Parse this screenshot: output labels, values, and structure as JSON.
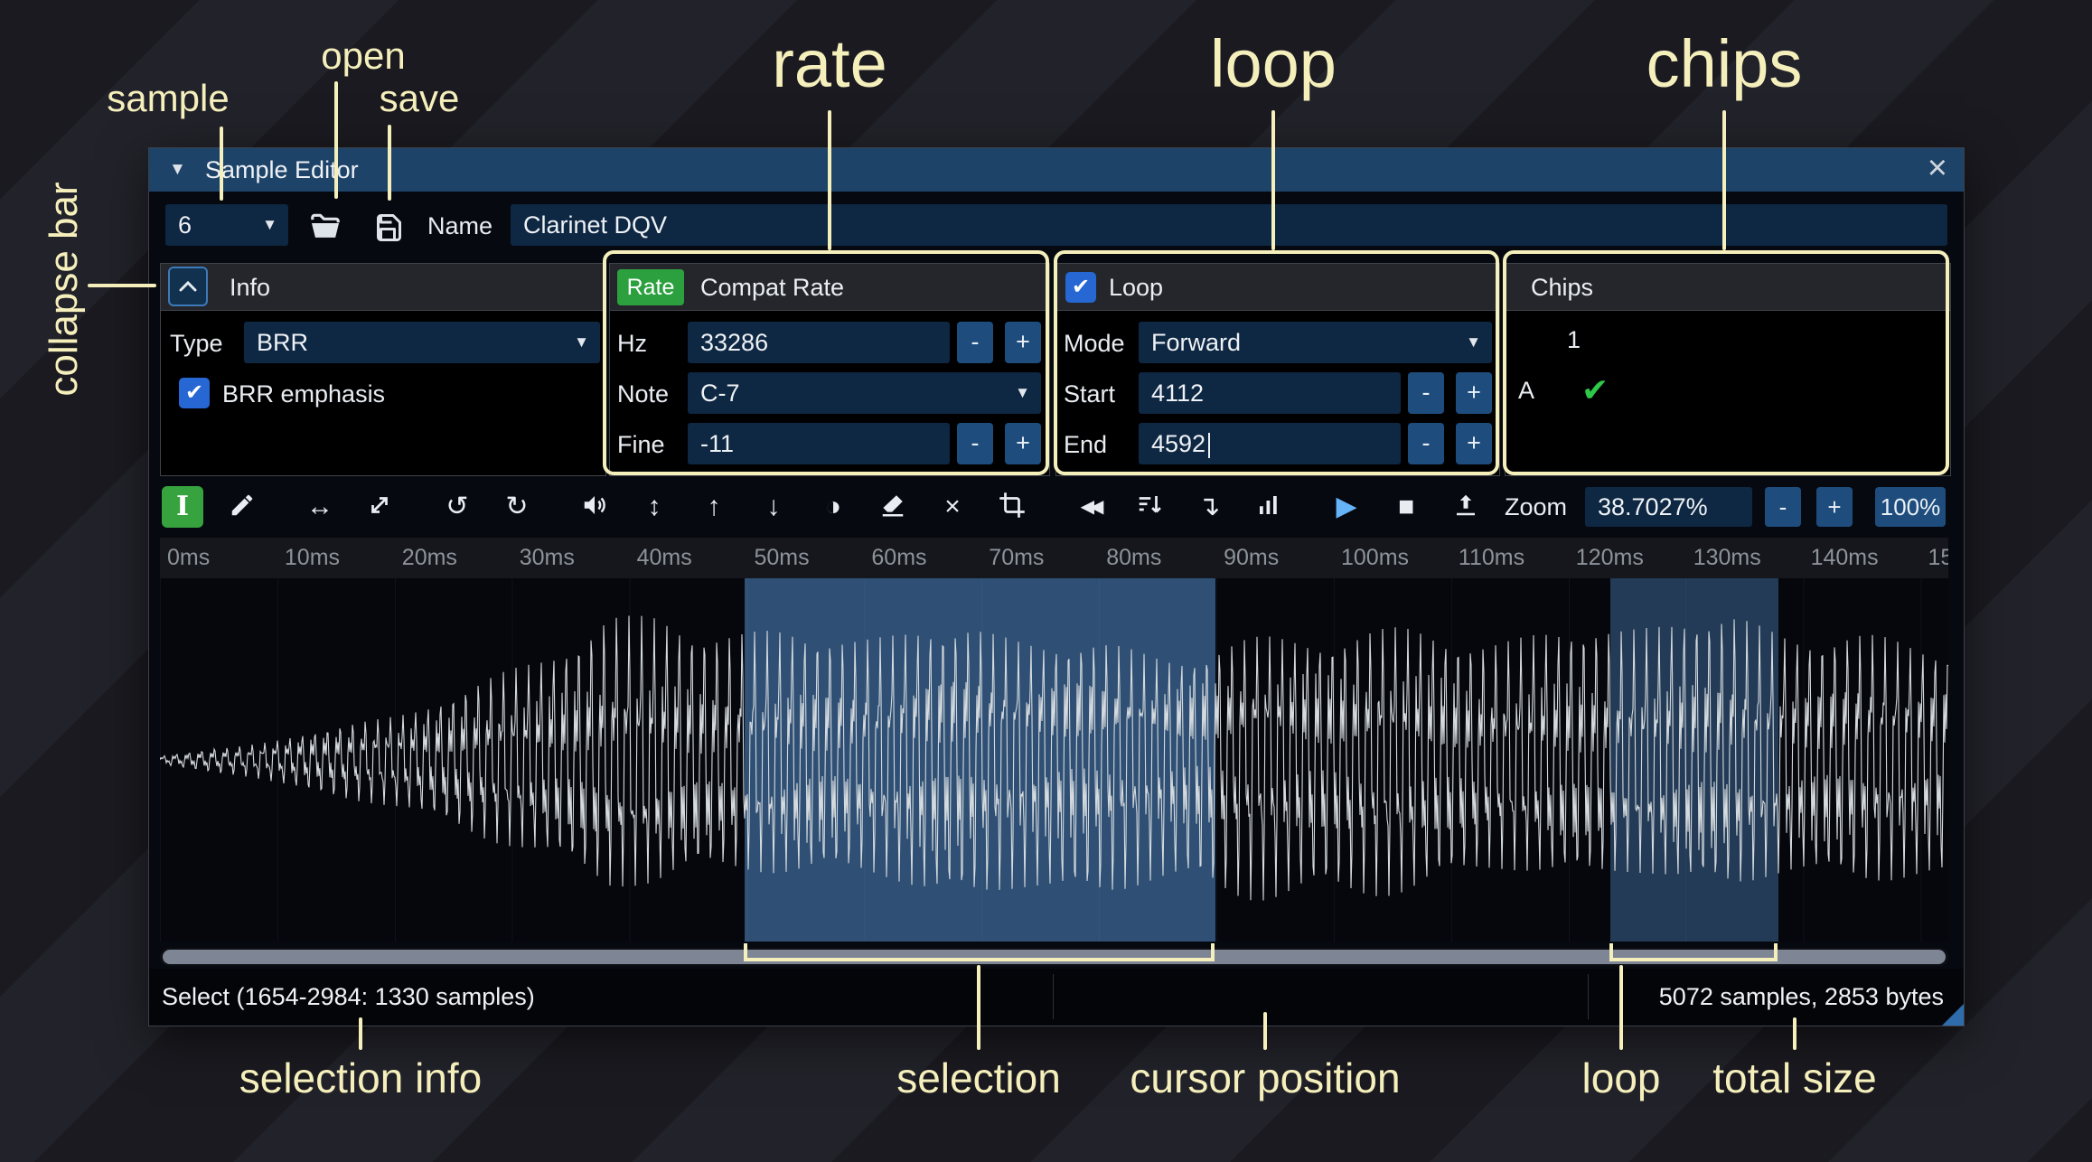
{
  "ui": {
    "dropdown_glyph": "▼",
    "check_glyph": "✔",
    "minus": "-",
    "plus": "+",
    "close_glyph": "×",
    "window_triangle": "▼"
  },
  "titlebar": {
    "title": "Sample Editor"
  },
  "file_row": {
    "sample_value": "6",
    "name_label": "Name",
    "name_value": "Clarinet DQV"
  },
  "info": {
    "header": "Info",
    "type_label": "Type",
    "type_value": "BRR",
    "emphasis_label": "BRR emphasis",
    "emphasis_checked": true
  },
  "rate": {
    "tab_rate": "Rate",
    "tab_compat": "Compat Rate",
    "hz_label": "Hz",
    "hz_value": "33286",
    "note_label": "Note",
    "note_value": "C-7",
    "fine_label": "Fine",
    "fine_value": "-11"
  },
  "loop_panel": {
    "header": "Loop",
    "enabled": true,
    "mode_label": "Mode",
    "mode_value": "Forward",
    "start_label": "Start",
    "start_value": "4112",
    "end_label": "End",
    "end_value": "4592"
  },
  "chips_panel": {
    "header": "Chips",
    "column_header": "1",
    "row_label": "A",
    "enabled": true
  },
  "toolbar": {
    "icons": [
      {
        "name": "edit-cursor-icon",
        "glyph": "I",
        "cls": "serif",
        "active": true
      },
      {
        "name": "pencil-icon",
        "shape": "pencil"
      },
      {
        "name": "arrows-horizontal-icon",
        "glyph": "↔"
      },
      {
        "name": "arrows-diagonal-icon",
        "shape": "diag"
      },
      {
        "name": "undo-icon",
        "glyph": "↺"
      },
      {
        "name": "redo-icon",
        "glyph": "↻"
      },
      {
        "name": "speaker-icon",
        "shape": "speaker"
      },
      {
        "name": "arrows-vertical-icon",
        "glyph": "↕"
      },
      {
        "name": "arrow-up-icon",
        "glyph": "↑"
      },
      {
        "name": "arrow-down-icon",
        "glyph": "↓"
      },
      {
        "name": "invert-circle-icon",
        "glyph": "◑"
      },
      {
        "name": "eraser-icon",
        "shape": "eraser"
      },
      {
        "name": "x-icon",
        "glyph": "×"
      },
      {
        "name": "crop-icon",
        "shape": "crop"
      },
      {
        "name": "fast-backward-icon",
        "glyph": "◀◀",
        "cls": "small"
      },
      {
        "name": "sort-descending-icon",
        "shape": "sort"
      },
      {
        "name": "arrow-turn-down-icon",
        "glyph": "↴"
      },
      {
        "name": "bar-chart-icon",
        "shape": "chart"
      },
      {
        "name": "play-icon",
        "glyph": "▶",
        "cls": "play"
      },
      {
        "name": "stop-icon",
        "glyph": "■"
      },
      {
        "name": "upload-icon",
        "shape": "upload"
      }
    ],
    "zoom_label": "Zoom",
    "zoom_value": "38.7027%",
    "zoom_out": "-",
    "zoom_in": "+",
    "zoom_reset": "100%"
  },
  "timeline": {
    "labels": [
      "0ms",
      "10ms",
      "20ms",
      "30ms",
      "40ms",
      "50ms",
      "60ms",
      "70ms",
      "80ms",
      "90ms",
      "100ms",
      "110ms",
      "120ms",
      "130ms",
      "140ms",
      "150"
    ]
  },
  "waveform": {
    "selection_start": 0.327,
    "selection_end": 0.59,
    "loop_start": 0.811,
    "loop_end": 0.905
  },
  "status": {
    "selection_text": "Select (1654-2984: 1330 samples)",
    "size_text": "5072 samples, 2853 bytes"
  },
  "annotations": {
    "sample": "sample",
    "open": "open",
    "save": "save",
    "rate": "rate",
    "loop": "loop",
    "chips": "chips",
    "collapse_bar": "collapse bar",
    "selection_info": "selection info",
    "selection": "selection",
    "cursor_position": "cursor position",
    "loop_region": "loop",
    "total_size": "total size"
  }
}
